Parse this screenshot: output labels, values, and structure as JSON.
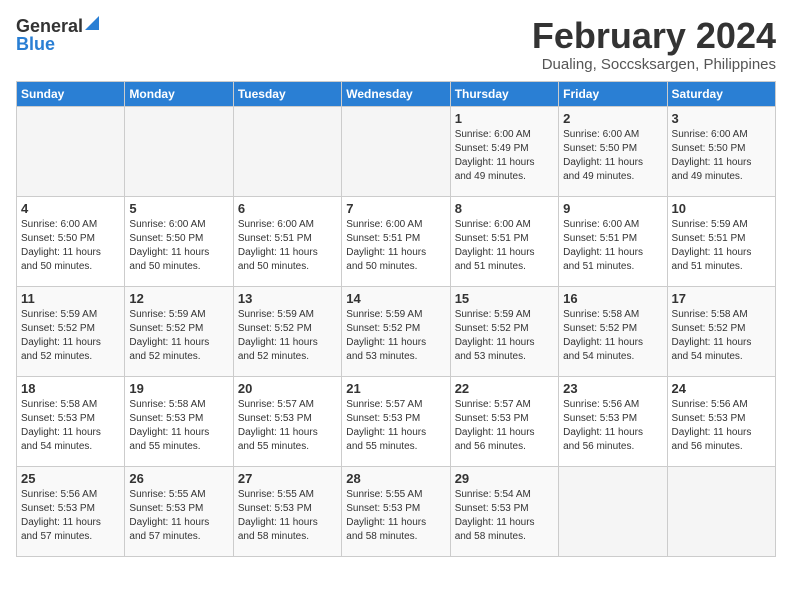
{
  "header": {
    "logo_general": "General",
    "logo_blue": "Blue",
    "month_title": "February 2024",
    "location": "Dualing, Soccsksargen, Philippines"
  },
  "columns": [
    "Sunday",
    "Monday",
    "Tuesday",
    "Wednesday",
    "Thursday",
    "Friday",
    "Saturday"
  ],
  "weeks": [
    [
      {
        "num": "",
        "text": ""
      },
      {
        "num": "",
        "text": ""
      },
      {
        "num": "",
        "text": ""
      },
      {
        "num": "",
        "text": ""
      },
      {
        "num": "1",
        "text": "Sunrise: 6:00 AM\nSunset: 5:49 PM\nDaylight: 11 hours\nand 49 minutes."
      },
      {
        "num": "2",
        "text": "Sunrise: 6:00 AM\nSunset: 5:50 PM\nDaylight: 11 hours\nand 49 minutes."
      },
      {
        "num": "3",
        "text": "Sunrise: 6:00 AM\nSunset: 5:50 PM\nDaylight: 11 hours\nand 49 minutes."
      }
    ],
    [
      {
        "num": "4",
        "text": "Sunrise: 6:00 AM\nSunset: 5:50 PM\nDaylight: 11 hours\nand 50 minutes."
      },
      {
        "num": "5",
        "text": "Sunrise: 6:00 AM\nSunset: 5:50 PM\nDaylight: 11 hours\nand 50 minutes."
      },
      {
        "num": "6",
        "text": "Sunrise: 6:00 AM\nSunset: 5:51 PM\nDaylight: 11 hours\nand 50 minutes."
      },
      {
        "num": "7",
        "text": "Sunrise: 6:00 AM\nSunset: 5:51 PM\nDaylight: 11 hours\nand 50 minutes."
      },
      {
        "num": "8",
        "text": "Sunrise: 6:00 AM\nSunset: 5:51 PM\nDaylight: 11 hours\nand 51 minutes."
      },
      {
        "num": "9",
        "text": "Sunrise: 6:00 AM\nSunset: 5:51 PM\nDaylight: 11 hours\nand 51 minutes."
      },
      {
        "num": "10",
        "text": "Sunrise: 5:59 AM\nSunset: 5:51 PM\nDaylight: 11 hours\nand 51 minutes."
      }
    ],
    [
      {
        "num": "11",
        "text": "Sunrise: 5:59 AM\nSunset: 5:52 PM\nDaylight: 11 hours\nand 52 minutes."
      },
      {
        "num": "12",
        "text": "Sunrise: 5:59 AM\nSunset: 5:52 PM\nDaylight: 11 hours\nand 52 minutes."
      },
      {
        "num": "13",
        "text": "Sunrise: 5:59 AM\nSunset: 5:52 PM\nDaylight: 11 hours\nand 52 minutes."
      },
      {
        "num": "14",
        "text": "Sunrise: 5:59 AM\nSunset: 5:52 PM\nDaylight: 11 hours\nand 53 minutes."
      },
      {
        "num": "15",
        "text": "Sunrise: 5:59 AM\nSunset: 5:52 PM\nDaylight: 11 hours\nand 53 minutes."
      },
      {
        "num": "16",
        "text": "Sunrise: 5:58 AM\nSunset: 5:52 PM\nDaylight: 11 hours\nand 54 minutes."
      },
      {
        "num": "17",
        "text": "Sunrise: 5:58 AM\nSunset: 5:52 PM\nDaylight: 11 hours\nand 54 minutes."
      }
    ],
    [
      {
        "num": "18",
        "text": "Sunrise: 5:58 AM\nSunset: 5:53 PM\nDaylight: 11 hours\nand 54 minutes."
      },
      {
        "num": "19",
        "text": "Sunrise: 5:58 AM\nSunset: 5:53 PM\nDaylight: 11 hours\nand 55 minutes."
      },
      {
        "num": "20",
        "text": "Sunrise: 5:57 AM\nSunset: 5:53 PM\nDaylight: 11 hours\nand 55 minutes."
      },
      {
        "num": "21",
        "text": "Sunrise: 5:57 AM\nSunset: 5:53 PM\nDaylight: 11 hours\nand 55 minutes."
      },
      {
        "num": "22",
        "text": "Sunrise: 5:57 AM\nSunset: 5:53 PM\nDaylight: 11 hours\nand 56 minutes."
      },
      {
        "num": "23",
        "text": "Sunrise: 5:56 AM\nSunset: 5:53 PM\nDaylight: 11 hours\nand 56 minutes."
      },
      {
        "num": "24",
        "text": "Sunrise: 5:56 AM\nSunset: 5:53 PM\nDaylight: 11 hours\nand 56 minutes."
      }
    ],
    [
      {
        "num": "25",
        "text": "Sunrise: 5:56 AM\nSunset: 5:53 PM\nDaylight: 11 hours\nand 57 minutes."
      },
      {
        "num": "26",
        "text": "Sunrise: 5:55 AM\nSunset: 5:53 PM\nDaylight: 11 hours\nand 57 minutes."
      },
      {
        "num": "27",
        "text": "Sunrise: 5:55 AM\nSunset: 5:53 PM\nDaylight: 11 hours\nand 58 minutes."
      },
      {
        "num": "28",
        "text": "Sunrise: 5:55 AM\nSunset: 5:53 PM\nDaylight: 11 hours\nand 58 minutes."
      },
      {
        "num": "29",
        "text": "Sunrise: 5:54 AM\nSunset: 5:53 PM\nDaylight: 11 hours\nand 58 minutes."
      },
      {
        "num": "",
        "text": ""
      },
      {
        "num": "",
        "text": ""
      }
    ]
  ]
}
